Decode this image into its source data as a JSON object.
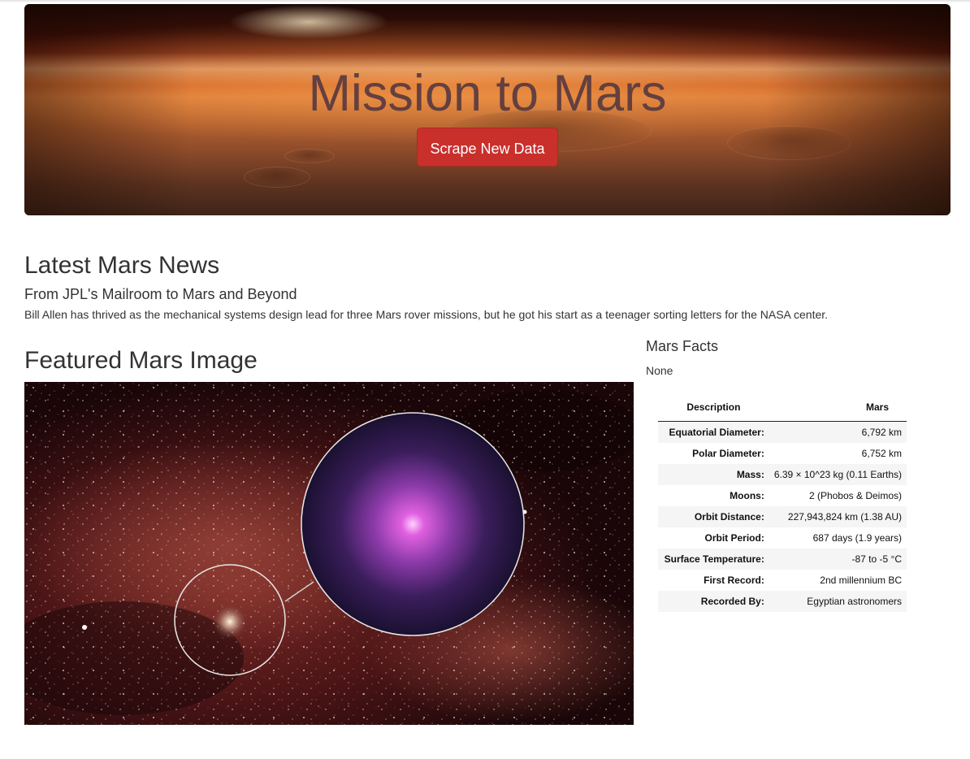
{
  "jumbotron": {
    "title": "Mission to Mars",
    "button_label": "Scrape New Data",
    "button_color": "#c9302c"
  },
  "news": {
    "section_title": "Latest Mars News",
    "headline": "From JPL's Mailroom to Mars and Beyond",
    "teaser": "Bill Allen has thrived as the mechanical systems design lead for three Mars rover missions, but he got his start as a teenager sorting letters for the NASA center."
  },
  "featured": {
    "section_title": "Featured Mars Image"
  },
  "facts": {
    "section_title": "Mars Facts",
    "note": "None",
    "headers": [
      "Description",
      "Mars"
    ],
    "rows": [
      {
        "label": "Equatorial Diameter:",
        "value": "6,792 km"
      },
      {
        "label": "Polar Diameter:",
        "value": "6,752 km"
      },
      {
        "label": "Mass:",
        "value": "6.39 × 10^23 kg (0.11 Earths)"
      },
      {
        "label": "Moons:",
        "value": "2 (Phobos & Deimos)"
      },
      {
        "label": "Orbit Distance:",
        "value": "227,943,824 km (1.38 AU)"
      },
      {
        "label": "Orbit Period:",
        "value": "687 days (1.9 years)"
      },
      {
        "label": "Surface Temperature:",
        "value": "-87 to -5 °C"
      },
      {
        "label": "First Record:",
        "value": "2nd millennium BC"
      },
      {
        "label": "Recorded By:",
        "value": "Egyptian astronomers"
      }
    ]
  }
}
